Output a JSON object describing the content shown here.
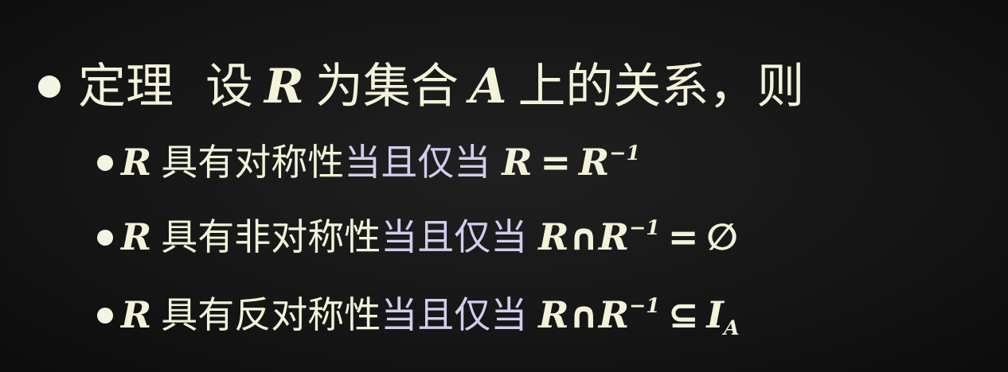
{
  "theorem": {
    "label": "定理",
    "intro_set": "设",
    "var_r": "R",
    "intro_mid": "为集合",
    "var_a": "A",
    "intro_end": "上的关系，则"
  },
  "items": [
    {
      "var": "R",
      "prop": "具有对称性",
      "cond": "当且仅当",
      "lhs": "R",
      "op": "=",
      "rhs": "R",
      "rhs_sup": "−1"
    },
    {
      "var": "R",
      "prop": "具有非对称性",
      "cond": "当且仅当",
      "lhs": "R",
      "cap": "∩",
      "lhs2": "R",
      "sup": "−1",
      "op": "=",
      "rhs": "∅"
    },
    {
      "var": "R",
      "prop": "具有反对称性",
      "cond": "当且仅当",
      "lhs": "R",
      "cap": "∩",
      "lhs2": "R",
      "sup": "−1",
      "op": "⊆",
      "rhs": "I",
      "rhs_sub": "A"
    }
  ]
}
